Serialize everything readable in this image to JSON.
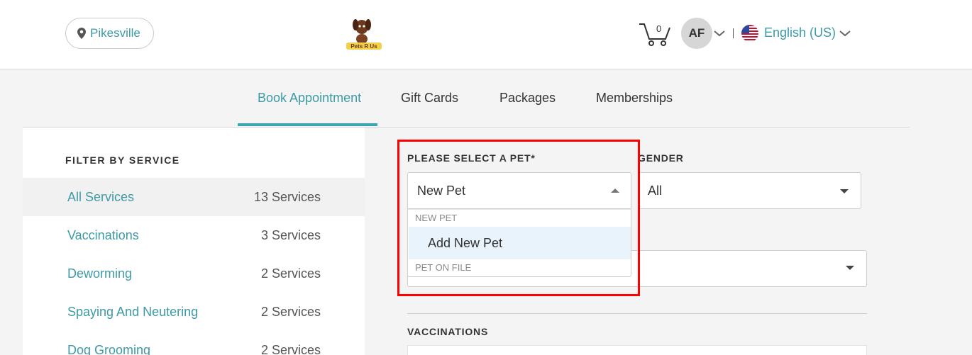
{
  "header": {
    "location": "Pikesville",
    "logo_text": "Pets R Us",
    "cart_count": "0",
    "avatar_initials": "AF",
    "language": "English (US)"
  },
  "tabs": [
    {
      "label": "Book Appointment",
      "active": true
    },
    {
      "label": "Gift Cards",
      "active": false
    },
    {
      "label": "Packages",
      "active": false
    },
    {
      "label": "Memberships",
      "active": false
    }
  ],
  "sidebar": {
    "title": "FILTER BY SERVICE",
    "services": [
      {
        "name": "All Services",
        "count": "13 Services",
        "active": true
      },
      {
        "name": "Vaccinations",
        "count": "3 Services"
      },
      {
        "name": "Deworming",
        "count": "2 Services"
      },
      {
        "name": "Spaying And Neutering",
        "count": "2 Services"
      },
      {
        "name": "Dog Grooming",
        "count": "2 Services"
      }
    ]
  },
  "form": {
    "pet_label": "PLEASE SELECT A PET*",
    "pet_value": "New Pet",
    "gender_label": "GENDER",
    "gender_value": "All",
    "dropdown": {
      "group_new": "NEW PET",
      "option_add": "Add New Pet",
      "group_on_file": "PET ON FILE"
    },
    "vaccinations_label": "VACCINATIONS"
  },
  "colors": {
    "accent": "#3d9aa6",
    "highlight": "#ff0000",
    "option_hover": "#e9f3fc"
  }
}
